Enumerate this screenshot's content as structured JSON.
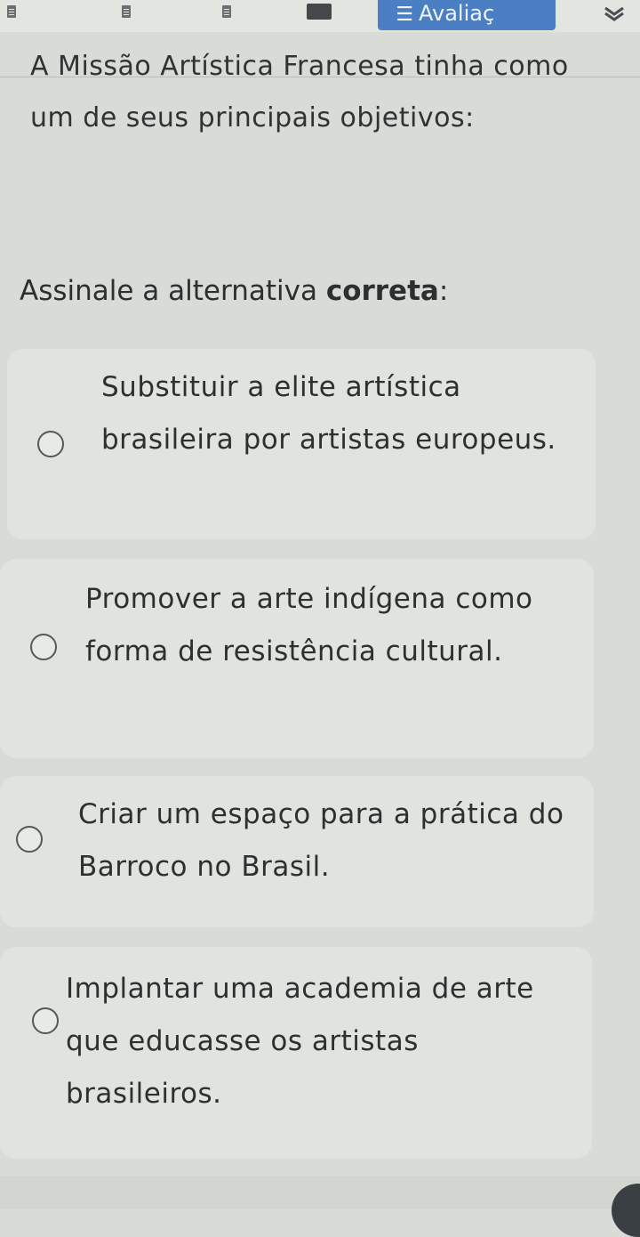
{
  "nav": {
    "active_tab_label": "Avaliaç",
    "icons": [
      "document-icon",
      "document-icon",
      "document-icon",
      "video-icon",
      "list-icon",
      "chevron-down-icon"
    ]
  },
  "question": {
    "text": "A Missão Artística Francesa tinha como um de seus principais objetivos:"
  },
  "instruction": {
    "prefix": "Assinale a alternativa ",
    "emphasis": "correta",
    "suffix": ":"
  },
  "options": [
    {
      "label": "Substituir a elite artística brasileira por artistas europeus."
    },
    {
      "label": "Promover a arte indígena como forma de resistência cultural."
    },
    {
      "label": "Criar um espaço para a prática do Barroco no Brasil."
    },
    {
      "label": "Implantar uma academia de arte que educasse os artistas brasileiros."
    }
  ],
  "colors": {
    "accent": "#4a7fc4",
    "card": "#e1e3df",
    "background": "#d9dbd6"
  }
}
